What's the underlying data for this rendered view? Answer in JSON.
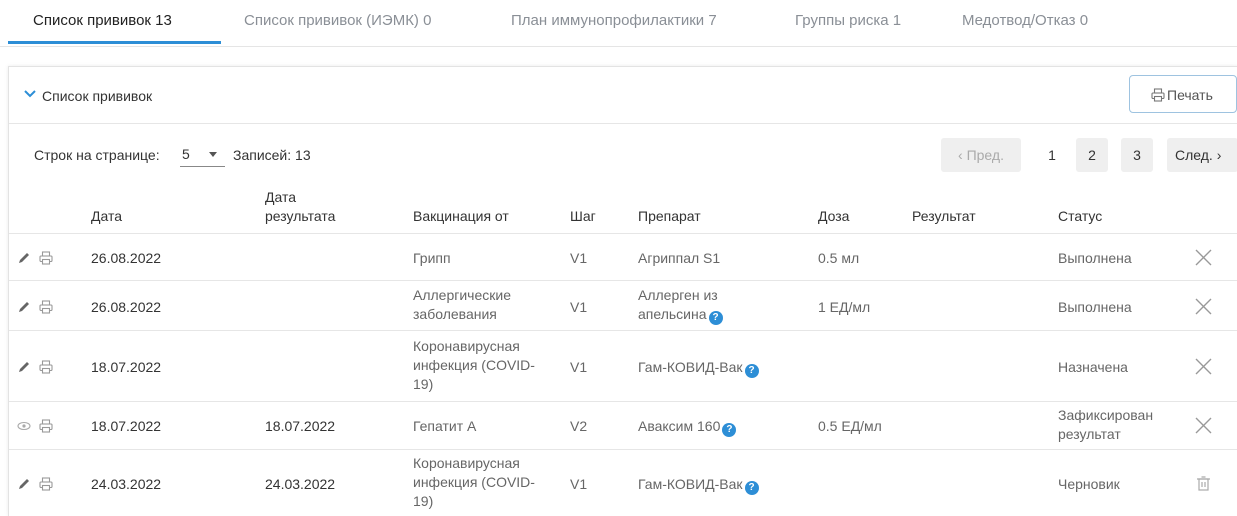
{
  "tabs": [
    {
      "label": "Список прививок 13"
    },
    {
      "label": "Список прививок (ИЭМК) 0"
    },
    {
      "label": "План иммунопрофилактики 7"
    },
    {
      "label": "Группы риска 1"
    },
    {
      "label": "Медотвод/Отказ 0"
    }
  ],
  "panel": {
    "title": "Список прививок",
    "print_label": "Печать"
  },
  "pager": {
    "rows_per_page_label": "Строк на странице:",
    "rows_per_page_value": "5",
    "records_label": "Записей:",
    "records_count": "13",
    "prev_label": "‹ Пред.",
    "pages": [
      "1",
      "2",
      "3"
    ],
    "next_label": "След. ›"
  },
  "table": {
    "headers": {
      "date": "Дата",
      "result_date": "Дата результата",
      "vaccination_from": "Вакцинация от",
      "step": "Шаг",
      "drug": "Препарат",
      "dose": "Доза",
      "result": "Результат",
      "status": "Статус"
    },
    "rows": [
      {
        "date": "26.08.2022",
        "result_date": "",
        "vaccination_from": "Грипп",
        "step": "V1",
        "drug": "Агриппал S1",
        "dose": "0.5 мл",
        "result": "",
        "status": "Выполнена"
      },
      {
        "date": "26.08.2022",
        "result_date": "",
        "vaccination_from": "Аллергические заболевания",
        "step": "V1",
        "drug": "Аллерген из апельсина",
        "dose": "1 ЕД/мл",
        "result": "",
        "status": "Выполнена"
      },
      {
        "date": "18.07.2022",
        "result_date": "",
        "vaccination_from": "Коронавирусная инфекция (COVID-19)",
        "step": "V1",
        "drug": "Гам-КОВИД-Вак",
        "dose": "",
        "result": "",
        "status": "Назначена"
      },
      {
        "date": "18.07.2022",
        "result_date": "18.07.2022",
        "vaccination_from": "Гепатит А",
        "step": "V2",
        "drug": "Аваксим 160",
        "dose": "0.5 ЕД/мл",
        "result": "",
        "status": "Зафиксирован результат"
      },
      {
        "date": "24.03.2022",
        "result_date": "24.03.2022",
        "vaccination_from": "Коронавирусная инфекция (COVID-19)",
        "step": "V1",
        "drug": "Гам-КОВИД-Вак",
        "dose": "",
        "result": "",
        "status": "Черновик"
      }
    ]
  },
  "colors": {
    "accent": "#2d8ed6",
    "muted": "#8a8f96",
    "border": "#e6e6e6"
  }
}
